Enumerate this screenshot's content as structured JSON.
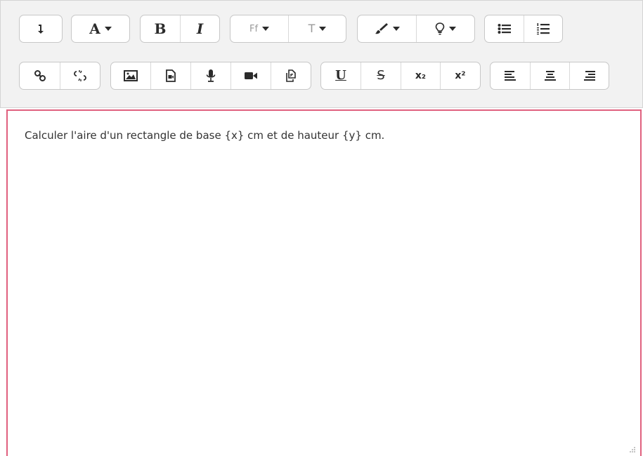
{
  "toolbar": {
    "row1": {
      "font_family_label": "Ff",
      "font_size_label": "T",
      "text_color_label": "A",
      "bold_label": "B",
      "italic_label": "I"
    },
    "row2": {
      "underline_label": "U",
      "strike_label": "S",
      "subscript_label": "x₂",
      "superscript_label": "x²"
    }
  },
  "editor": {
    "content": "Calculer l'aire d'un rectangle de base {x} cm et de hauteur {y} cm."
  },
  "colors": {
    "focus_border": "#e0607e",
    "toolbar_bg": "#f2f2f2"
  },
  "icons": [
    "collapse-icon",
    "text-color-icon",
    "bold-icon",
    "italic-icon",
    "font-family-icon",
    "font-size-icon",
    "paintbrush-icon",
    "lightbulb-icon",
    "unordered-list-icon",
    "ordered-list-icon",
    "link-icon",
    "unlink-icon",
    "image-icon",
    "media-icon",
    "microphone-icon",
    "video-icon",
    "manage-files-icon",
    "underline-icon",
    "strikethrough-icon",
    "subscript-icon",
    "superscript-icon",
    "align-left-icon",
    "align-center-icon",
    "align-right-icon",
    "resize-handle-icon"
  ]
}
